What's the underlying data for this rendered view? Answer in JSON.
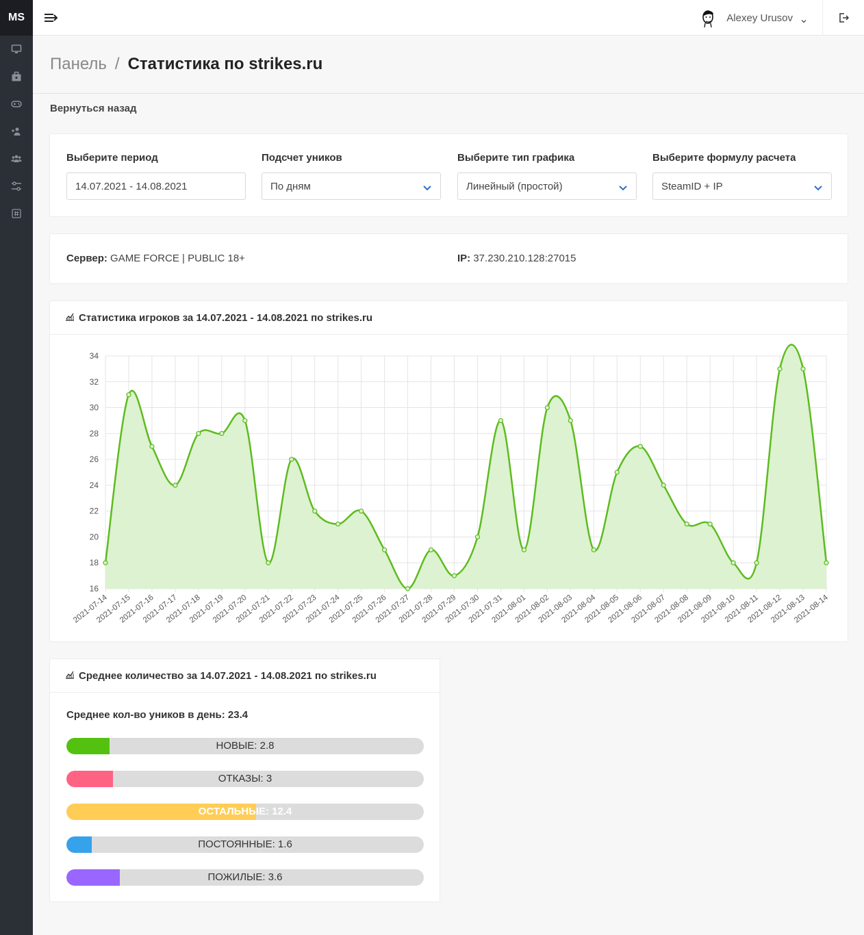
{
  "app": {
    "logo": "MS"
  },
  "sidebar": {
    "icons": [
      "monitor-icon",
      "briefcase-icon",
      "gamepad-icon",
      "users-add-icon",
      "users-icon",
      "sliders-icon",
      "hashtag-icon"
    ]
  },
  "topbar": {
    "user_name": "Alexey Urusov"
  },
  "breadcrumb": {
    "root": "Панель",
    "separator": "/",
    "current": "Статистика по strikes.ru"
  },
  "back_link": "Вернуться назад",
  "filters": [
    {
      "label": "Выберите период",
      "value": "14.07.2021 - 14.08.2021",
      "dropdown": false
    },
    {
      "label": "Подсчет уников",
      "value": "По дням",
      "dropdown": true
    },
    {
      "label": "Выберите тип графика",
      "value": "Линейный (простой)",
      "dropdown": true
    },
    {
      "label": "Выберите формулу расчета",
      "value": "SteamID + IP",
      "dropdown": true
    }
  ],
  "server": {
    "server_label": "Сервер:",
    "server_value": "GAME FORCE | PUBLIC 18+",
    "ip_label": "IP:",
    "ip_value": "37.230.210.128:27015"
  },
  "chart_card": {
    "title": "Статистика игроков за 14.07.2021 - 14.08.2021 по strikes.ru"
  },
  "chart_data": {
    "type": "area",
    "x": [
      "2021-07-14",
      "2021-07-15",
      "2021-07-16",
      "2021-07-17",
      "2021-07-18",
      "2021-07-19",
      "2021-07-20",
      "2021-07-21",
      "2021-07-22",
      "2021-07-23",
      "2021-07-24",
      "2021-07-25",
      "2021-07-26",
      "2021-07-27",
      "2021-07-28",
      "2021-07-29",
      "2021-07-30",
      "2021-07-31",
      "2021-08-01",
      "2021-08-02",
      "2021-08-03",
      "2021-08-04",
      "2021-08-05",
      "2021-08-06",
      "2021-08-07",
      "2021-08-08",
      "2021-08-09",
      "2021-08-10",
      "2021-08-11",
      "2021-08-12",
      "2021-08-13",
      "2021-08-14"
    ],
    "values": [
      18,
      31,
      27,
      24,
      28,
      28,
      29,
      18,
      26,
      22,
      21,
      22,
      19,
      16,
      19,
      17,
      20,
      29,
      19,
      30,
      29,
      19,
      25,
      27,
      24,
      21,
      21,
      18,
      18,
      33,
      33,
      18
    ],
    "ylim": [
      16,
      34
    ],
    "yticks": [
      16,
      18,
      20,
      22,
      24,
      26,
      28,
      30,
      32,
      34
    ],
    "grid": true,
    "line_color": "#5dbb1e",
    "fill_color": "#dcf2d0"
  },
  "avg_card": {
    "title": "Среднее количество за 14.07.2021 - 14.08.2021 по strikes.ru",
    "daily_avg": "Среднее кол-во уников в день: 23.4",
    "bars": [
      {
        "label": "НОВЫЕ: 2.8",
        "value": 2.8,
        "color": "#54c111",
        "fill_pct": 12
      },
      {
        "label": "ОТКАЗЫ: 3",
        "value": 3,
        "color": "#ff6384",
        "fill_pct": 13
      },
      {
        "label": "ОСТАЛЬНЫЕ: 12.4",
        "value": 12.4,
        "color": "#ffcd56",
        "fill_pct": 53
      },
      {
        "label": "ПОСТОЯННЫЕ: 1.6",
        "value": 1.6,
        "color": "#36a2eb",
        "fill_pct": 7
      },
      {
        "label": "ПОЖИЛЫЕ: 3.6",
        "value": 3.6,
        "color": "#9966ff",
        "fill_pct": 15
      }
    ]
  }
}
